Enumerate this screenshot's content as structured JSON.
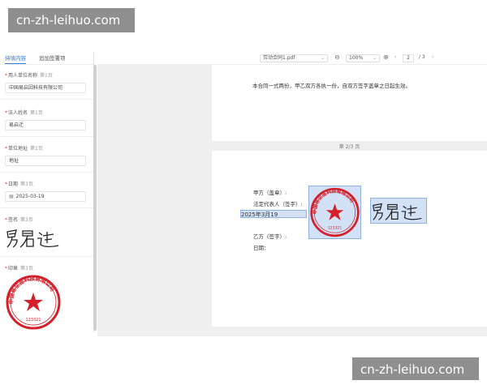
{
  "watermark": "cn-zh-leihuo.com",
  "tabs": [
    {
      "label": "待填内容",
      "active": true
    },
    {
      "label": "追加签署项",
      "active": false
    }
  ],
  "fields": [
    {
      "label": "用人单位名称",
      "page": "第1页",
      "value": "中国易启因科技有限公司"
    },
    {
      "label": "法人姓名",
      "page": "第1页",
      "value": "易启迁"
    },
    {
      "label": "单位地址",
      "page": "第1页",
      "value": "地址"
    },
    {
      "label": "日期",
      "page": "第3页",
      "value": "2025-03-19"
    },
    {
      "label": "签名",
      "page": "第3页"
    },
    {
      "label": "印章",
      "page": "第3页"
    }
  ],
  "signature_text": "易启迁",
  "seal": {
    "org_text": "中国易企签科技有限公司",
    "code": "123321"
  },
  "toolbar": {
    "file_name": "劳动合同1.pdf",
    "zoom": "100%",
    "current_page": "2",
    "total_pages": "/ 3"
  },
  "document": {
    "page1_text": "本合同一式两份，甲乙双方各执一份，自双方签字盖章之日起生效。",
    "page_label": "第 2/3 页",
    "party_a": "甲方（盖章）:",
    "legal_rep": "法定代表人（签字）:",
    "date_value": "2025年3月19",
    "party_b": "乙方（签字）:",
    "date_label": "日期："
  }
}
